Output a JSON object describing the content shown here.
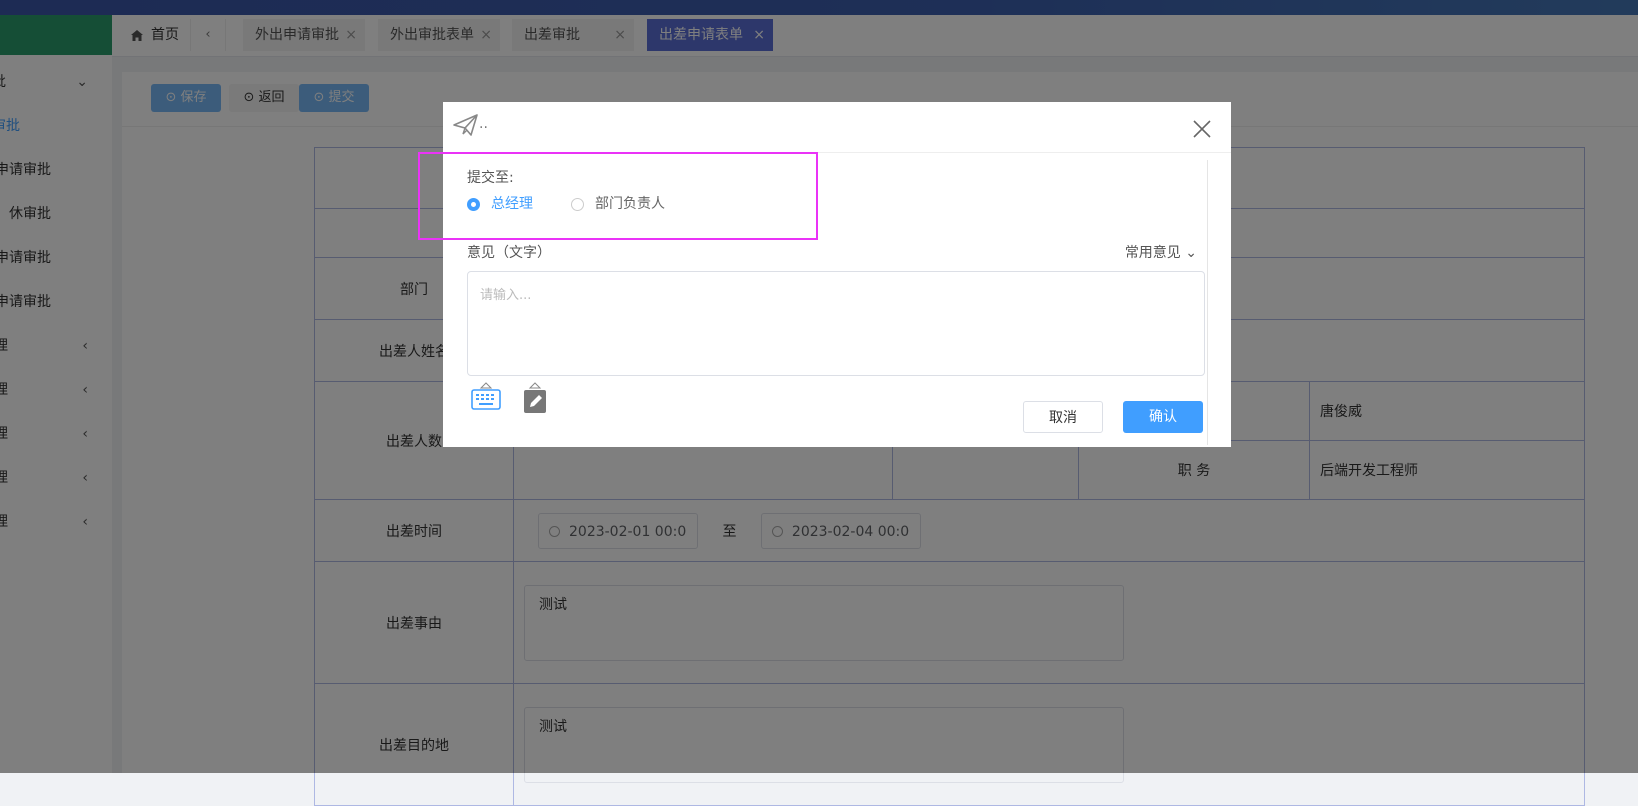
{
  "colors": {
    "accent": "#409eff",
    "tab_active": "#5b6fd6",
    "highlight": "#ea33f7",
    "sidebar_head": "#2b9d6c"
  },
  "sidebar": {
    "items": [
      {
        "label": "批",
        "icon": "chevron-down-icon"
      },
      {
        "label": "审批"
      },
      {
        "label": "申请审批"
      },
      {
        "label": "休审批"
      },
      {
        "label": "申请审批"
      },
      {
        "label": "申请审批"
      },
      {
        "label": "理",
        "icon": "chevron-left-icon"
      },
      {
        "label": "理",
        "icon": "chevron-left-icon"
      },
      {
        "label": "理",
        "icon": "chevron-left-icon"
      },
      {
        "label": "理",
        "icon": "chevron-left-icon"
      },
      {
        "label": "理",
        "icon": "chevron-left-icon"
      }
    ]
  },
  "tabs": {
    "home": "首页",
    "items": [
      {
        "label": "外出申请审批"
      },
      {
        "label": "外出审批表单"
      },
      {
        "label": "出差审批"
      },
      {
        "label": "出差申请表单"
      }
    ],
    "close": "×"
  },
  "toolbar": {
    "save": "⊙ 保存",
    "back": "⊙ 返回",
    "submit": "⊙ 提交"
  },
  "form": {
    "dept_label": "部门",
    "name_label": "出差人姓名",
    "count_label": "出差人数",
    "person_name": "唐俊威",
    "position_label": "职 务",
    "position_value": "后端开发工程师",
    "time_label": "出差时间",
    "start_time": "2023-02-01 00:0",
    "to": "至",
    "end_time": "2023-02-04 00:0",
    "reason_label": "出差事由",
    "reason_value": "测试",
    "destination_label": "出差目的地",
    "destination_value": "测试"
  },
  "dialog": {
    "title_dots": "..",
    "submit_to_label": "提交至:",
    "options": [
      {
        "label": "总经理",
        "checked": true
      },
      {
        "label": "部门负责人",
        "checked": false
      }
    ],
    "opinion_label": "意见（文字）",
    "common_opinion": "常用意见",
    "textarea_placeholder": "请输入...",
    "cancel": "取消",
    "confirm": "确认"
  }
}
